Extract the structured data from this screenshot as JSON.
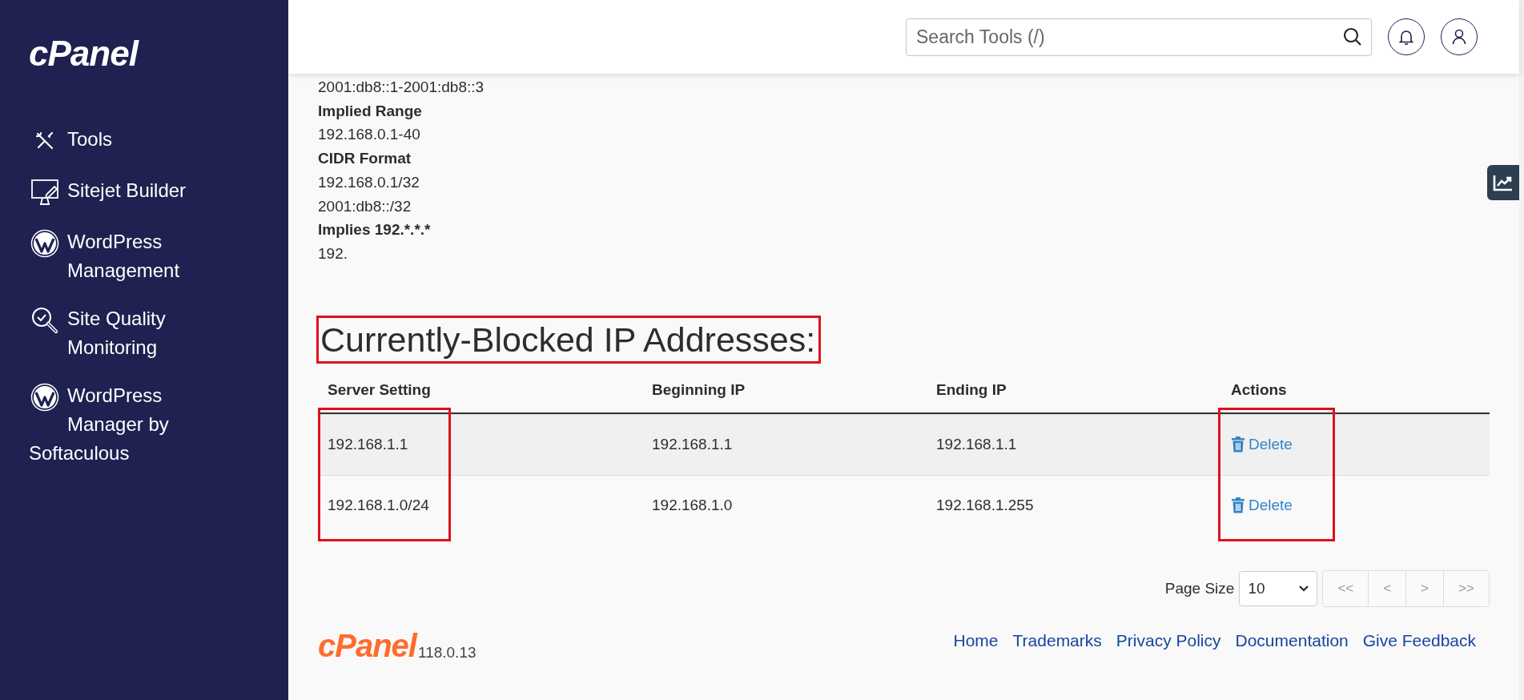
{
  "sidebar": {
    "logo": "cPanel",
    "items": [
      {
        "label": "Tools",
        "kind": "tools"
      },
      {
        "label": "Sitejet Builder",
        "kind": "builder"
      },
      {
        "label": "WordPress Management",
        "kind": "wordpress"
      },
      {
        "label": "Site Quality Monitoring",
        "kind": "monitoring"
      },
      {
        "label": "WordPress Manager by Softaculous",
        "kind": "wordpress"
      }
    ]
  },
  "topbar": {
    "search": {
      "placeholder": "Search Tools (/)"
    }
  },
  "help_lines": [
    {
      "text": "2001:db8::1-2001:db8::3",
      "bold": false
    },
    {
      "text": "Implied Range",
      "bold": true
    },
    {
      "text": "192.168.0.1-40",
      "bold": false
    },
    {
      "text": "CIDR Format",
      "bold": true
    },
    {
      "text": "192.168.0.1/32",
      "bold": false
    },
    {
      "text": "2001:db8::/32",
      "bold": false
    },
    {
      "text": "Implies 192.*.*.*",
      "bold": true
    },
    {
      "text": "192.",
      "bold": false
    }
  ],
  "heading": {
    "text": "Currently-Blocked IP Addresses:",
    "highlighted": true
  },
  "table": {
    "columns": [
      {
        "label": "Server Setting",
        "highlighted": true
      },
      {
        "label": "Beginning IP",
        "highlighted": false
      },
      {
        "label": "Ending IP",
        "highlighted": false
      },
      {
        "label": "Actions",
        "highlighted": true
      }
    ],
    "rows": [
      {
        "cells": [
          "192.168.1.1",
          "192.168.1.1",
          "192.168.1.1"
        ],
        "action": "Delete"
      },
      {
        "cells": [
          "192.168.1.0/24",
          "192.168.1.0",
          "192.168.1.255"
        ],
        "action": "Delete"
      }
    ]
  },
  "pagination": {
    "page_size_label": "Page Size",
    "page_size": "10",
    "buttons": [
      {
        "label": "<<",
        "disabled": true
      },
      {
        "label": "<",
        "disabled": true
      },
      {
        "label": ">",
        "disabled": true
      },
      {
        "label": ">>",
        "disabled": true
      }
    ]
  },
  "footer": {
    "logo": "cPanel",
    "version": "118.0.13",
    "links": [
      "Home",
      "Trademarks",
      "Privacy Policy",
      "Documentation",
      "Give Feedback"
    ]
  }
}
